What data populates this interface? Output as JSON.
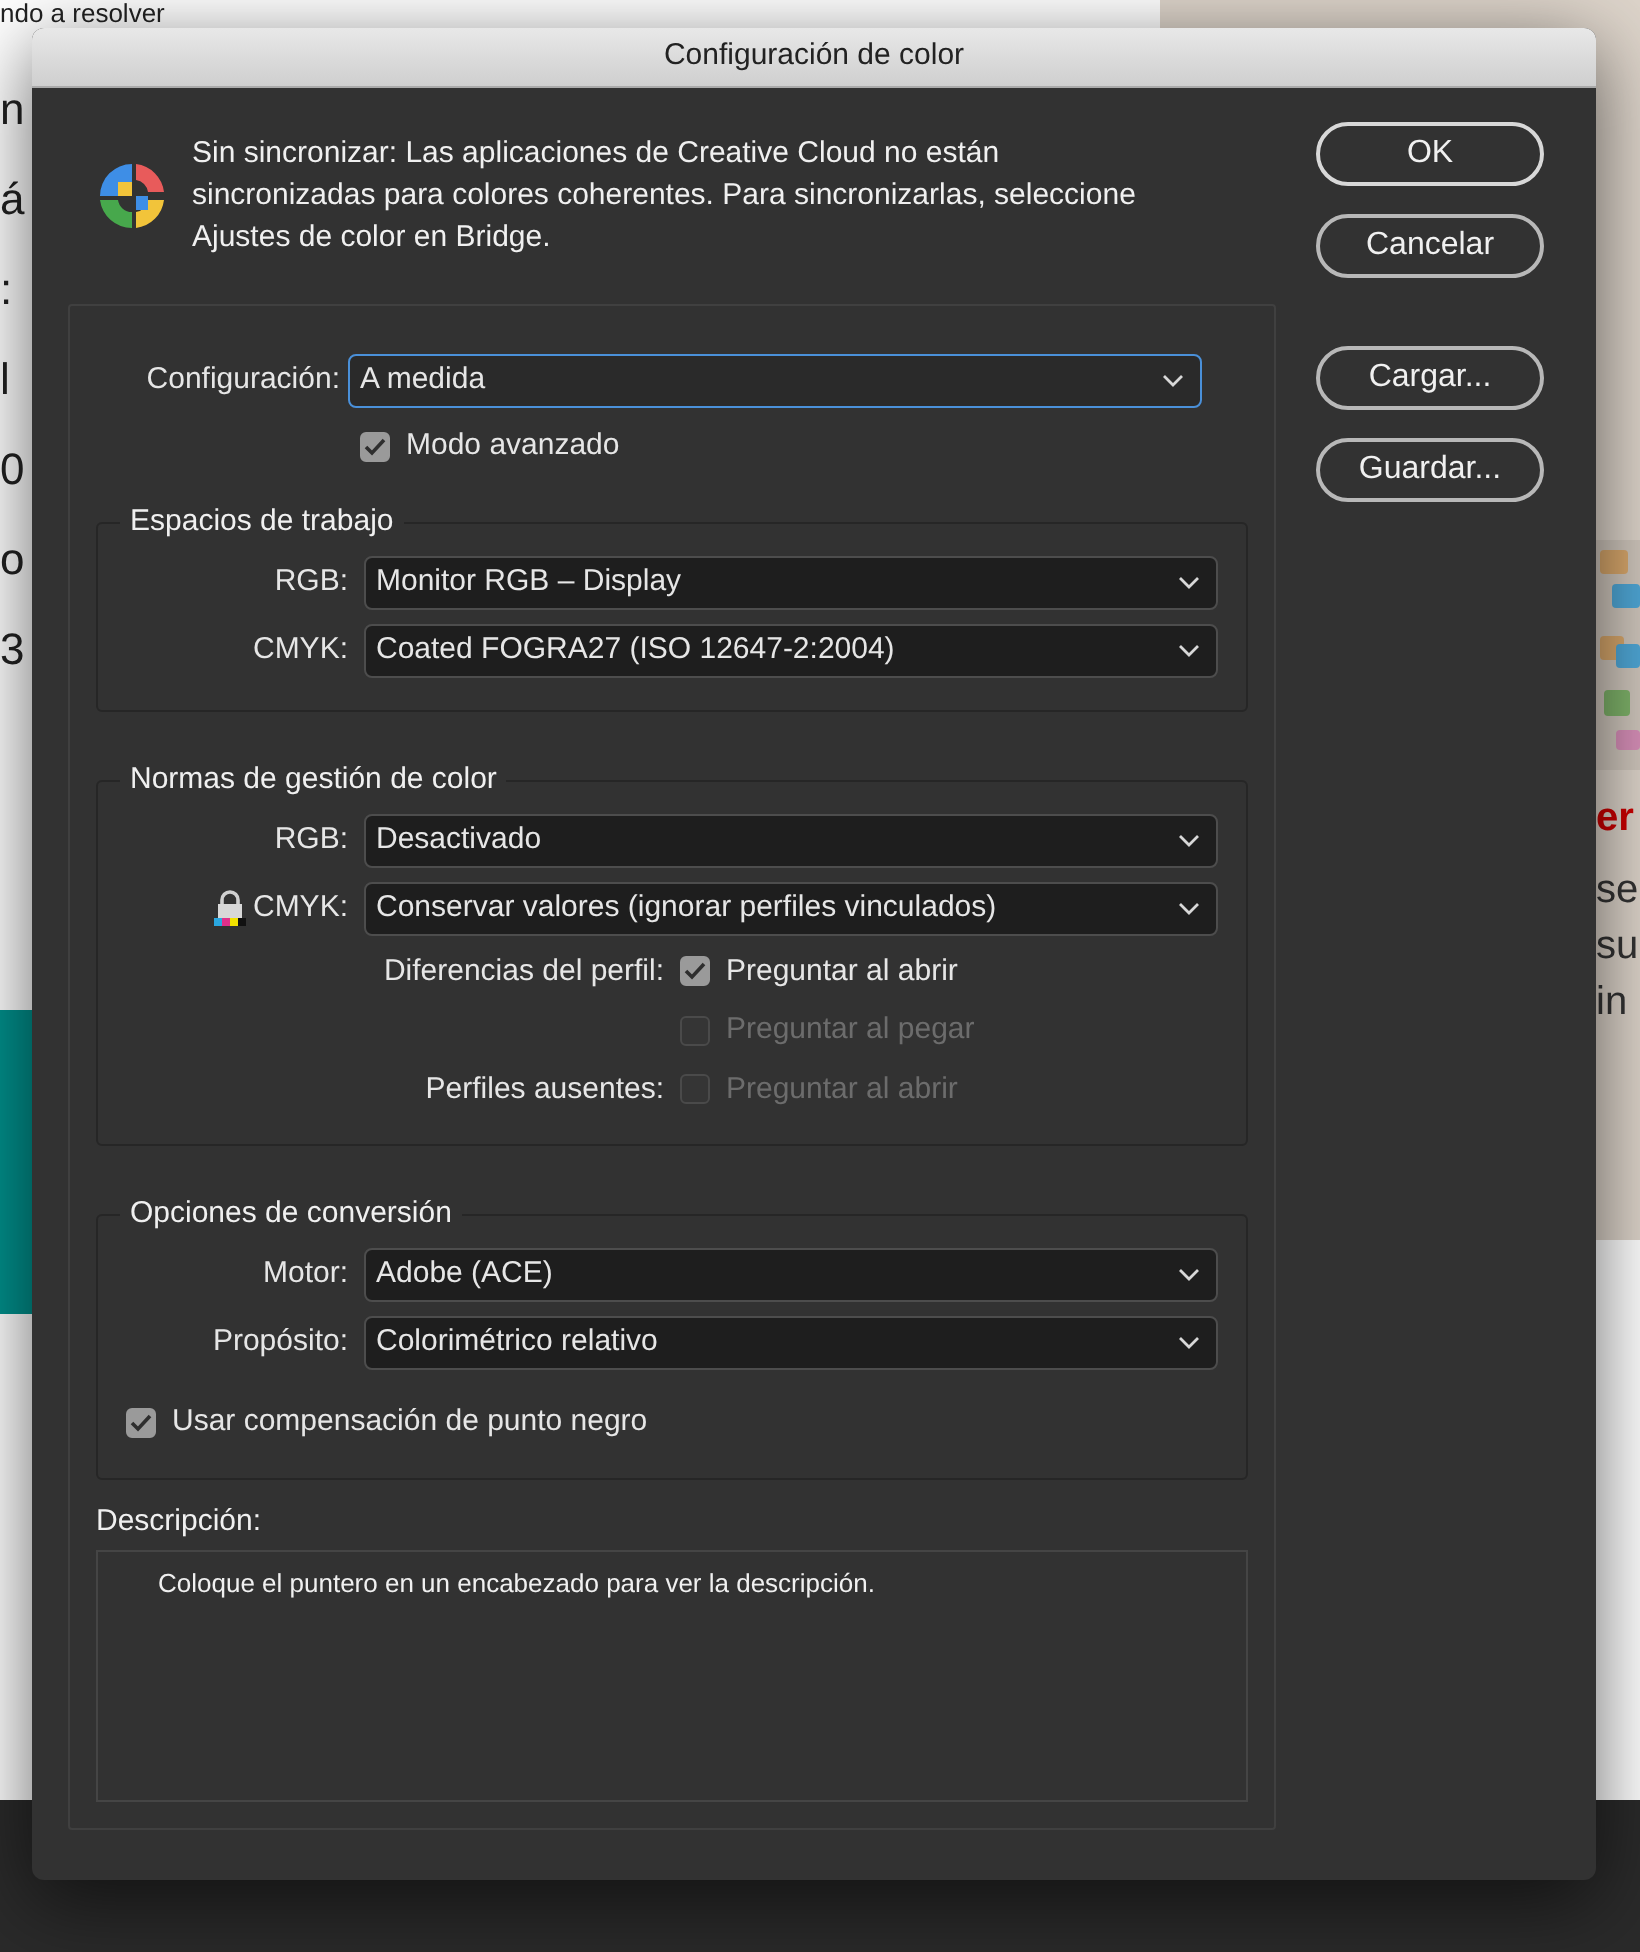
{
  "background": {
    "top_text": "ndo a resolver",
    "left_fragments": [
      "n",
      "á",
      ":",
      "l",
      "0",
      "o",
      "3"
    ],
    "right_fragments": [
      {
        "text": "er",
        "kind": "heading"
      },
      {
        "text": "se",
        "kind": "body"
      },
      {
        "text": "su",
        "kind": "body"
      },
      {
        "text": "in",
        "kind": "body"
      }
    ]
  },
  "window": {
    "title": "Configuración de color"
  },
  "message": "Sin sincronizar: Las aplicaciones de Creative Cloud no están sincronizadas para colores coherentes. Para sincronizarlas, seleccione Ajustes de color en Bridge.",
  "buttons": [
    {
      "label": "OK",
      "default": true
    },
    {
      "label": "Cancelar",
      "default": false
    },
    {
      "label": "Cargar...",
      "default": false
    },
    {
      "label": "Guardar...",
      "default": false
    }
  ],
  "configuration": {
    "label": "Configuración:",
    "value": "A medida",
    "focused": true
  },
  "advanced_mode": {
    "label": "Modo avanzado",
    "checked": true
  },
  "groups": [
    {
      "title": "Espacios de trabajo",
      "rows": [
        {
          "kind": "select",
          "label": "RGB:",
          "value": "Monitor RGB – Display",
          "locked": false
        },
        {
          "kind": "select",
          "label": "CMYK:",
          "value": "Coated FOGRA27 (ISO 12647-2:2004)",
          "locked": false
        }
      ]
    },
    {
      "title": "Normas de gestión de color",
      "rows": [
        {
          "kind": "select",
          "label": "RGB:",
          "value": "Desactivado",
          "locked": false
        },
        {
          "kind": "select",
          "label": "CMYK:",
          "value": "Conservar valores (ignorar perfiles vinculados)",
          "locked": true
        },
        {
          "kind": "checkbox",
          "label": "Diferencias del perfil:",
          "option": "Preguntar al abrir",
          "checked": true,
          "disabled": false
        },
        {
          "kind": "checkbox",
          "option": "Preguntar al pegar",
          "checked": false,
          "disabled": true
        },
        {
          "kind": "checkbox",
          "label": "Perfiles ausentes:",
          "option": "Preguntar al abrir",
          "checked": false,
          "disabled": true
        }
      ]
    },
    {
      "title": "Opciones de conversión",
      "rows": [
        {
          "kind": "select",
          "label": "Motor:",
          "value": "Adobe (ACE)",
          "locked": false
        },
        {
          "kind": "select",
          "label": "Propósito:",
          "value": "Colorimétrico relativo",
          "locked": false
        },
        {
          "kind": "option",
          "option": "Usar compensación de punto negro",
          "checked": true,
          "disabled": false
        }
      ]
    }
  ],
  "description": {
    "label": "Descripción:",
    "text": "Coloque el puntero en un encabezado para ver la descripción."
  }
}
